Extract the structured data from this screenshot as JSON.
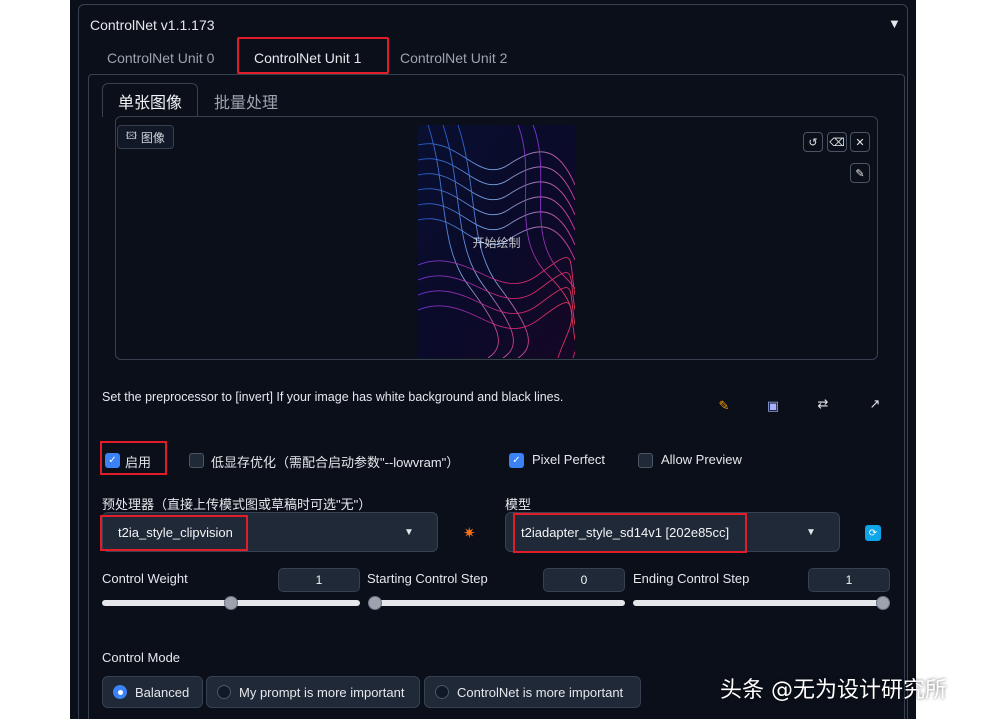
{
  "panel": {
    "title": "ControlNet v1.1.173",
    "collapse_icon": "▼"
  },
  "unit_tabs": [
    {
      "label": "ControlNet Unit 0",
      "active": false
    },
    {
      "label": "ControlNet Unit 1",
      "active": true
    },
    {
      "label": "ControlNet Unit 2",
      "active": false
    }
  ],
  "input_tabs": [
    {
      "label": "单张图像",
      "active": true
    },
    {
      "label": "批量处理",
      "active": false
    }
  ],
  "image_input": {
    "label": "图像",
    "canvas_hint": "开始绘制",
    "tools": [
      "undo-icon",
      "eraser-icon",
      "close-icon",
      "brush-icon"
    ]
  },
  "hint_text": "Set the preprocessor to [invert] If your image has white background and black lines.",
  "action_icons": [
    "edit-icon",
    "camera-icon",
    "swap-icon",
    "send-dimensions-icon"
  ],
  "checkboxes": {
    "enable": {
      "label": "启用",
      "checked": true
    },
    "low_vram": {
      "label": "低显存优化（需配合启动参数\"--lowvram\"）",
      "checked": false
    },
    "pixel_perfect": {
      "label": "Pixel Perfect",
      "checked": true
    },
    "allow_preview": {
      "label": "Allow Preview",
      "checked": false
    }
  },
  "preprocessor": {
    "label": "预处理器（直接上传模式图或草稿时可选\"无\"）",
    "value": "t2ia_style_clipvision"
  },
  "model": {
    "label": "模型",
    "value": "t2iadapter_style_sd14v1 [202e85cc]"
  },
  "sliders": {
    "control_weight": {
      "label": "Control Weight",
      "value": "1",
      "fraction": 0.5
    },
    "starting_step": {
      "label": "Starting Control Step",
      "value": "0",
      "fraction": 0.0
    },
    "ending_step": {
      "label": "Ending Control Step",
      "value": "1",
      "fraction": 1.0
    }
  },
  "control_mode": {
    "label": "Control Mode",
    "options": [
      {
        "label": "Balanced",
        "selected": true
      },
      {
        "label": "My prompt is more important",
        "selected": false
      },
      {
        "label": "ControlNet is more important",
        "selected": false
      }
    ]
  },
  "watermark": "头条 @无为设计研究所",
  "colors": {
    "background": "#0b0f19",
    "accent": "#3b82f6",
    "highlight_box": "#e11d2a",
    "refresh": "#0ea5e9"
  }
}
